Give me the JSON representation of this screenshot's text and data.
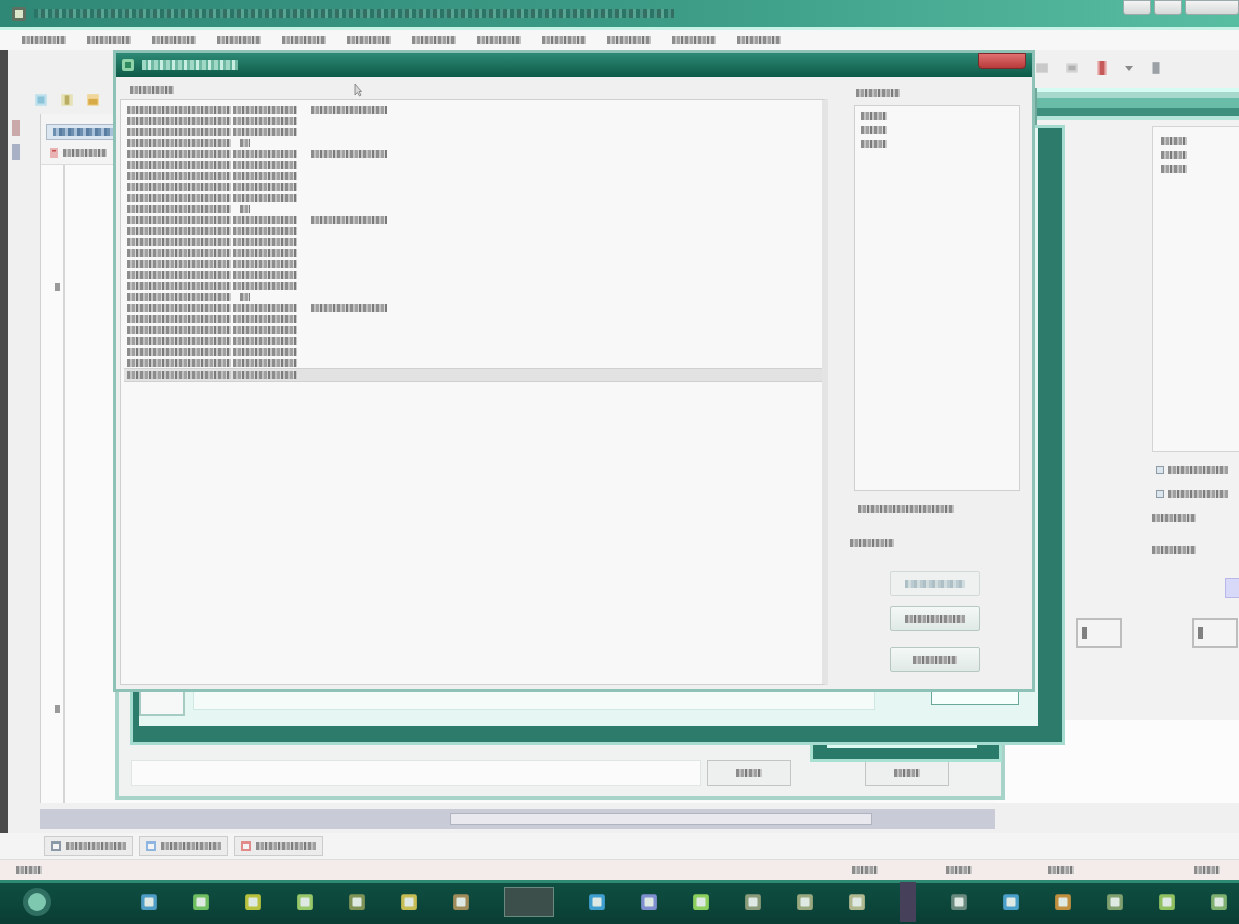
{
  "main_window": {
    "title": {
      "kind": "title"
    },
    "menu": [
      {
        "kind": "short"
      },
      {
        "kind": "short"
      },
      {
        "kind": "short"
      },
      {
        "kind": "short"
      },
      {
        "kind": "short"
      },
      {
        "kind": "short"
      },
      {
        "kind": "short"
      },
      {
        "kind": "short"
      },
      {
        "kind": "short"
      },
      {
        "kind": "short"
      },
      {
        "kind": "short"
      },
      {
        "kind": "short"
      }
    ],
    "project_tab": {
      "kind": "medium"
    },
    "project_item": {
      "kind": "short"
    },
    "bottom_tabs": [
      {
        "kind": "medium"
      },
      {
        "kind": "medium"
      },
      {
        "kind": "medium"
      }
    ],
    "status_bar": [
      {
        "kind": "tiny"
      },
      {
        "kind": "tiny"
      },
      {
        "kind": "tiny"
      },
      {
        "kind": "tiny"
      },
      {
        "kind": "tiny"
      }
    ]
  },
  "back_dialog": {
    "buttons": [
      {
        "kind": "tiny"
      },
      {
        "kind": "tiny"
      }
    ]
  },
  "side_window": {
    "list": [
      {
        "kind": "tiny"
      },
      {
        "kind": "tiny"
      },
      {
        "kind": "tiny"
      }
    ],
    "options": [
      {
        "kind": "medium",
        "checked": false
      },
      {
        "kind": "medium",
        "checked": false
      }
    ],
    "labels": [
      {
        "kind": "short"
      },
      {
        "kind": "short"
      }
    ]
  },
  "dialog": {
    "title": {
      "kind": "long"
    },
    "list_label": {
      "kind": "short"
    },
    "rows": [
      {
        "kind": "header",
        "selected": false
      },
      {
        "kind": "item",
        "selected": false
      },
      {
        "kind": "item",
        "selected": false
      },
      {
        "kind": "group",
        "selected": false
      },
      {
        "kind": "header",
        "selected": false
      },
      {
        "kind": "item",
        "selected": false
      },
      {
        "kind": "item",
        "selected": false
      },
      {
        "kind": "item",
        "selected": false
      },
      {
        "kind": "item",
        "selected": false
      },
      {
        "kind": "group",
        "selected": false
      },
      {
        "kind": "header",
        "selected": false
      },
      {
        "kind": "item",
        "selected": false
      },
      {
        "kind": "item",
        "selected": false
      },
      {
        "kind": "item",
        "selected": false
      },
      {
        "kind": "item",
        "selected": false
      },
      {
        "kind": "item",
        "selected": false
      },
      {
        "kind": "item",
        "selected": false
      },
      {
        "kind": "group",
        "selected": false
      },
      {
        "kind": "header",
        "selected": false
      },
      {
        "kind": "item",
        "selected": false
      },
      {
        "kind": "item",
        "selected": false
      },
      {
        "kind": "item",
        "selected": false
      },
      {
        "kind": "item",
        "selected": false
      },
      {
        "kind": "item",
        "selected": false
      },
      {
        "kind": "item",
        "selected": true
      }
    ],
    "side_label": {
      "kind": "short"
    },
    "side_list": [
      {
        "kind": "tiny"
      },
      {
        "kind": "tiny"
      },
      {
        "kind": "tiny"
      }
    ],
    "option": {
      "kind": "long"
    },
    "field_label": {
      "kind": "short"
    },
    "buttons": [
      {
        "kind": "medium",
        "disabled": true
      },
      {
        "kind": "medium",
        "disabled": false
      },
      {
        "kind": "short",
        "disabled": false
      }
    ]
  }
}
